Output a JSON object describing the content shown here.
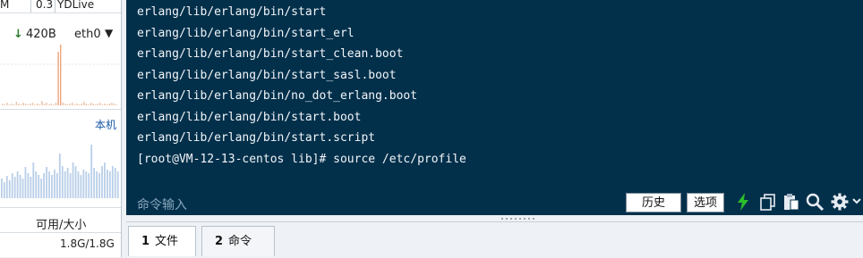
{
  "monitor": {
    "top_cells": [
      "M",
      "0.3",
      "YDLive"
    ],
    "network": {
      "speed": "420B",
      "interface": "eth0",
      "direction_icon": "down-arrow-icon"
    },
    "local_label": "本机",
    "disk": {
      "header": "可用/大小",
      "value": "1.8G/1.8G"
    }
  },
  "terminal": {
    "lines": [
      "erlang/lib/erlang/bin/start",
      "erlang/lib/erlang/bin/start_erl",
      "erlang/lib/erlang/bin/start_clean.boot",
      "erlang/lib/erlang/bin/start_sasl.boot",
      "erlang/lib/erlang/bin/no_dot_erlang.boot",
      "erlang/lib/erlang/bin/start.boot",
      "erlang/lib/erlang/bin/start.script",
      "[root@VM-12-13-centos lib]# source /etc/profile"
    ],
    "command_placeholder": "命令输入",
    "buttons": {
      "history": "历史",
      "options": "选项"
    },
    "icons": [
      "bolt-icon",
      "copy-icon",
      "paste-icon",
      "search-icon",
      "gear-icon",
      "chevron-down-icon"
    ],
    "colors": {
      "background": "#02304b",
      "text": "#f2f5f8",
      "bolt": "#2bbf2b"
    }
  },
  "tabs": [
    {
      "number": "1",
      "label": "文件"
    },
    {
      "number": "2",
      "label": "命令"
    }
  ]
}
